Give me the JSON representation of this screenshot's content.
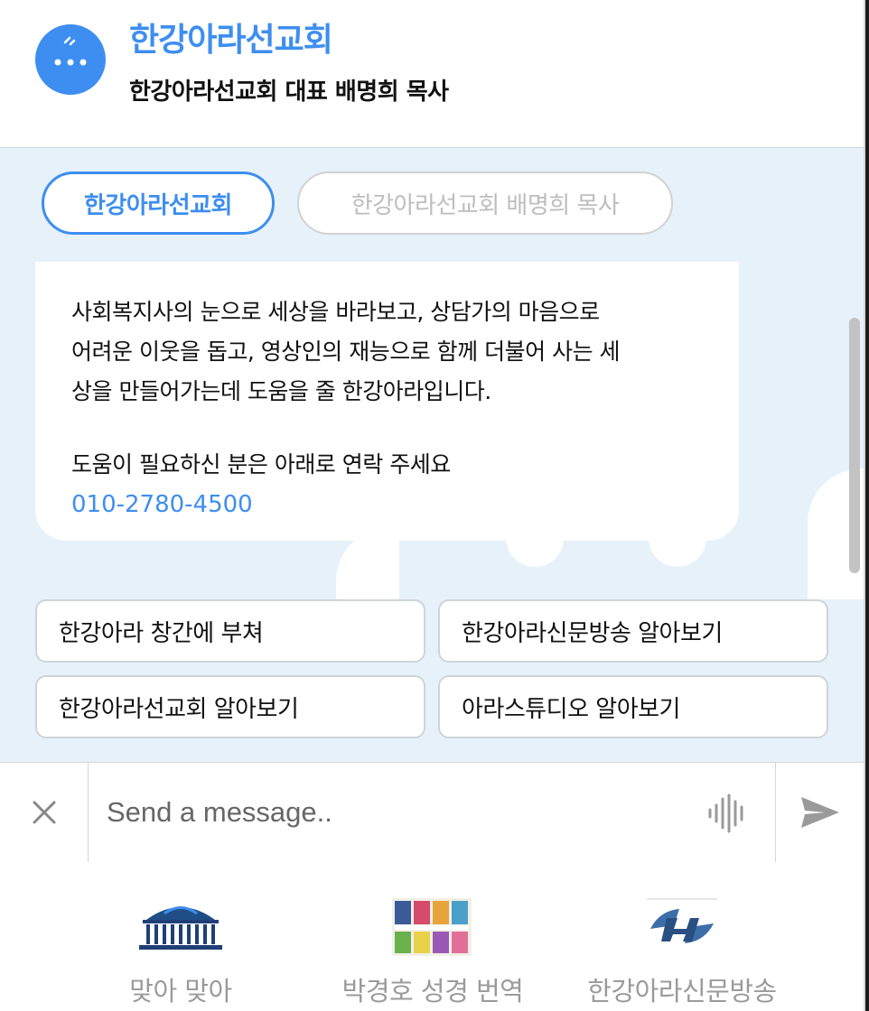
{
  "header": {
    "title": "한강아라선교회",
    "subtitle": "한강아라선교회 대표 배명희 목사"
  },
  "tabs": [
    {
      "label": "한강아라선교회",
      "active": true
    },
    {
      "label": "한강아라선교회 배명희 목사",
      "active": false
    }
  ],
  "message": {
    "line1": "사회복지사의 눈으로 세상을 바라보고, 상담가의 마음으로",
    "line2": "어려운 이웃을 돕고, 영상인의 재능으로 함께 더불어 사는 세",
    "line3": "상을 만들어가는데 도움을 줄 한강아라입니다.",
    "line4": "도움이 필요하신 분은 아래로 연락 주세요",
    "phone": "010-2780-4500"
  },
  "quick_replies": [
    "한강아라 창간에 부쳐",
    "한강아라신문방송 알아보기",
    "한강아라선교회 알아보기",
    "아라스튜디오 알아보기"
  ],
  "input": {
    "placeholder": "Send a message.."
  },
  "footer_links": [
    {
      "label": "맞아 맞아",
      "icon": "assembly-building-icon"
    },
    {
      "label": "박경호 성경 번역",
      "icon": "bible-books-icon"
    },
    {
      "label": "한강아라신문방송",
      "icon": "h-logo-icon"
    }
  ],
  "colors": {
    "accent": "#3d8ef0",
    "chat_background": "#e6f1fa",
    "muted_text": "#9a9a9a"
  }
}
